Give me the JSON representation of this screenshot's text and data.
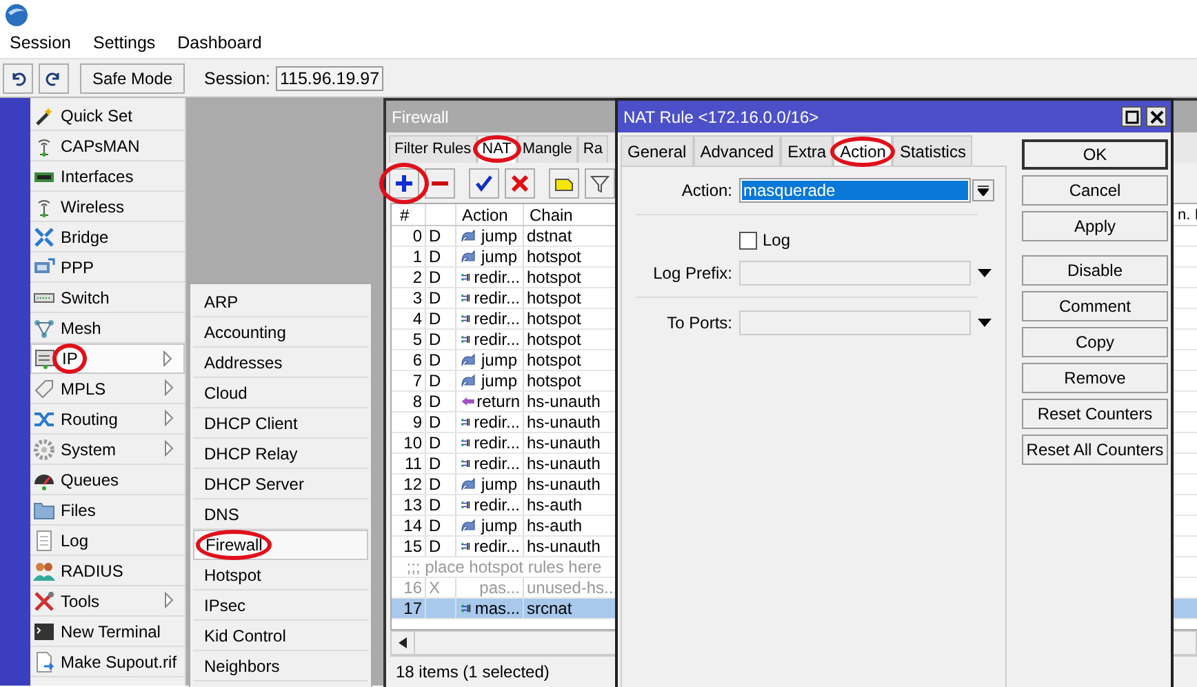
{
  "menu_bar": [
    {
      "label": "Session"
    },
    {
      "label": "Settings"
    },
    {
      "label": "Dashboard"
    }
  ],
  "toolbar": {
    "safe_mode": "Safe Mode",
    "session_label": "Session:",
    "session_value": "115.96.19.97"
  },
  "sidebar": {
    "items": [
      {
        "label": "Quick Set",
        "has_submenu": false,
        "selected": false,
        "circled": false
      },
      {
        "label": "CAPsMAN",
        "has_submenu": false,
        "selected": false,
        "circled": false
      },
      {
        "label": "Interfaces",
        "has_submenu": false,
        "selected": false,
        "circled": false
      },
      {
        "label": "Wireless",
        "has_submenu": false,
        "selected": false,
        "circled": false
      },
      {
        "label": "Bridge",
        "has_submenu": false,
        "selected": false,
        "circled": false
      },
      {
        "label": "PPP",
        "has_submenu": false,
        "selected": false,
        "circled": false
      },
      {
        "label": "Switch",
        "has_submenu": false,
        "selected": false,
        "circled": false
      },
      {
        "label": "Mesh",
        "has_submenu": false,
        "selected": false,
        "circled": false
      },
      {
        "label": "IP",
        "has_submenu": true,
        "selected": true,
        "circled": true
      },
      {
        "label": "MPLS",
        "has_submenu": true,
        "selected": false,
        "circled": false
      },
      {
        "label": "Routing",
        "has_submenu": true,
        "selected": false,
        "circled": false
      },
      {
        "label": "System",
        "has_submenu": true,
        "selected": false,
        "circled": false
      },
      {
        "label": "Queues",
        "has_submenu": false,
        "selected": false,
        "circled": false
      },
      {
        "label": "Files",
        "has_submenu": false,
        "selected": false,
        "circled": false
      },
      {
        "label": "Log",
        "has_submenu": false,
        "selected": false,
        "circled": false
      },
      {
        "label": "RADIUS",
        "has_submenu": false,
        "selected": false,
        "circled": false
      },
      {
        "label": "Tools",
        "has_submenu": true,
        "selected": false,
        "circled": false
      },
      {
        "label": "New Terminal",
        "has_submenu": false,
        "selected": false,
        "circled": false
      },
      {
        "label": "Make Supout.rif",
        "has_submenu": false,
        "selected": false,
        "circled": false
      }
    ]
  },
  "submenu": {
    "items": [
      {
        "label": "ARP",
        "selected": false,
        "circled": false
      },
      {
        "label": "Accounting",
        "selected": false,
        "circled": false
      },
      {
        "label": "Addresses",
        "selected": false,
        "circled": false
      },
      {
        "label": "Cloud",
        "selected": false,
        "circled": false
      },
      {
        "label": "DHCP Client",
        "selected": false,
        "circled": false
      },
      {
        "label": "DHCP Relay",
        "selected": false,
        "circled": false
      },
      {
        "label": "DHCP Server",
        "selected": false,
        "circled": false
      },
      {
        "label": "DNS",
        "selected": false,
        "circled": false
      },
      {
        "label": "Firewall",
        "selected": true,
        "circled": true
      },
      {
        "label": "Hotspot",
        "selected": false,
        "circled": false
      },
      {
        "label": "IPsec",
        "selected": false,
        "circled": false
      },
      {
        "label": "Kid Control",
        "selected": false,
        "circled": false
      },
      {
        "label": "Neighbors",
        "selected": false,
        "circled": false
      }
    ]
  },
  "firewall": {
    "title": "Firewall",
    "tabs": [
      {
        "label": "Filter Rules",
        "selected": false,
        "circled": false
      },
      {
        "label": "NAT",
        "selected": true,
        "circled": true
      },
      {
        "label": "Mangle",
        "selected": false,
        "circled": false
      },
      {
        "label": "Ra",
        "selected": false,
        "circled": false
      }
    ],
    "tools": [
      {
        "kind": "add",
        "circled": true
      },
      {
        "kind": "remove",
        "circled": false
      },
      {
        "kind": "enable",
        "circled": false
      },
      {
        "kind": "disable",
        "circled": false
      },
      {
        "kind": "comment",
        "circled": false
      },
      {
        "kind": "filter",
        "circled": false
      }
    ],
    "table": {
      "columns": [
        "#",
        "",
        "Action",
        "Chain"
      ],
      "column_edge": "n. I",
      "rows": [
        {
          "kind": "jump",
          "number": "0",
          "flag": "D",
          "action": "jump",
          "chain": "dstnat",
          "selected": false,
          "disabled": false
        },
        {
          "kind": "jump",
          "number": "1",
          "flag": "D",
          "action": "jump",
          "chain": "hotspot",
          "selected": false,
          "disabled": false
        },
        {
          "kind": "redirect",
          "number": "2",
          "flag": "D",
          "action": "redir...",
          "chain": "hotspot",
          "selected": false,
          "disabled": false
        },
        {
          "kind": "redirect",
          "number": "3",
          "flag": "D",
          "action": "redir...",
          "chain": "hotspot",
          "selected": false,
          "disabled": false
        },
        {
          "kind": "redirect",
          "number": "4",
          "flag": "D",
          "action": "redir...",
          "chain": "hotspot",
          "selected": false,
          "disabled": false
        },
        {
          "kind": "redirect",
          "number": "5",
          "flag": "D",
          "action": "redir...",
          "chain": "hotspot",
          "selected": false,
          "disabled": false
        },
        {
          "kind": "jump",
          "number": "6",
          "flag": "D",
          "action": "jump",
          "chain": "hotspot",
          "selected": false,
          "disabled": false
        },
        {
          "kind": "jump",
          "number": "7",
          "flag": "D",
          "action": "jump",
          "chain": "hotspot",
          "selected": false,
          "disabled": false
        },
        {
          "kind": "return",
          "number": "8",
          "flag": "D",
          "action": "return",
          "chain": "hs-unauth",
          "selected": false,
          "disabled": false
        },
        {
          "kind": "redirect",
          "number": "9",
          "flag": "D",
          "action": "redir...",
          "chain": "hs-unauth",
          "selected": false,
          "disabled": false
        },
        {
          "kind": "redirect",
          "number": "10",
          "flag": "D",
          "action": "redir...",
          "chain": "hs-unauth",
          "selected": false,
          "disabled": false
        },
        {
          "kind": "redirect",
          "number": "11",
          "flag": "D",
          "action": "redir...",
          "chain": "hs-unauth",
          "selected": false,
          "disabled": false
        },
        {
          "kind": "jump",
          "number": "12",
          "flag": "D",
          "action": "jump",
          "chain": "hs-unauth",
          "selected": false,
          "disabled": false
        },
        {
          "kind": "redirect",
          "number": "13",
          "flag": "D",
          "action": "redir...",
          "chain": "hs-auth",
          "selected": false,
          "disabled": false
        },
        {
          "kind": "jump",
          "number": "14",
          "flag": "D",
          "action": "jump",
          "chain": "hs-auth",
          "selected": false,
          "disabled": false
        },
        {
          "kind": "redirect",
          "number": "15",
          "flag": "D",
          "action": "redir...",
          "chain": "hs-unauth",
          "selected": false,
          "disabled": false
        },
        {
          "kind": "comment",
          "text": ";;; place hotspot rules here"
        },
        {
          "kind": "plain",
          "number": "16",
          "flag": "X",
          "action": "pas...",
          "chain": "unused-hs...",
          "selected": false,
          "disabled": true
        },
        {
          "kind": "redirect",
          "number": "17",
          "action": "mas...",
          "chain": "srcnat",
          "selected": true,
          "disabled": false
        }
      ]
    },
    "status": "18 items (1 selected)"
  },
  "nat_rule": {
    "title": "NAT Rule <172.16.0.0/16>",
    "tabs": [
      {
        "label": "General",
        "selected": false,
        "circled": false
      },
      {
        "label": "Advanced",
        "selected": false,
        "circled": false
      },
      {
        "label": "Extra",
        "selected": false,
        "circled": false
      },
      {
        "label": "Action",
        "selected": true,
        "circled": true
      },
      {
        "label": "Statistics",
        "selected": false,
        "circled": false
      }
    ],
    "fields": [
      {
        "kind": "select",
        "label": "Action:",
        "value": "masquerade"
      },
      {
        "kind": "separator"
      },
      {
        "kind": "checkbox",
        "label": "Log",
        "checked": false
      },
      {
        "kind": "dropdown",
        "label": "Log Prefix:"
      },
      {
        "kind": "separator"
      },
      {
        "kind": "dropdown",
        "label": "To Ports:"
      }
    ],
    "button_groups": [
      [
        {
          "label": "OK",
          "default": true
        },
        {
          "label": "Cancel",
          "default": false
        },
        {
          "label": "Apply",
          "default": false
        }
      ],
      [
        {
          "label": "Disable",
          "default": false
        },
        {
          "label": "Comment",
          "default": false
        },
        {
          "label": "Copy",
          "default": false
        },
        {
          "label": "Remove",
          "default": false
        },
        {
          "label": "Reset Counters",
          "default": false
        },
        {
          "label": "Reset All Counters",
          "default": false
        }
      ]
    ]
  }
}
